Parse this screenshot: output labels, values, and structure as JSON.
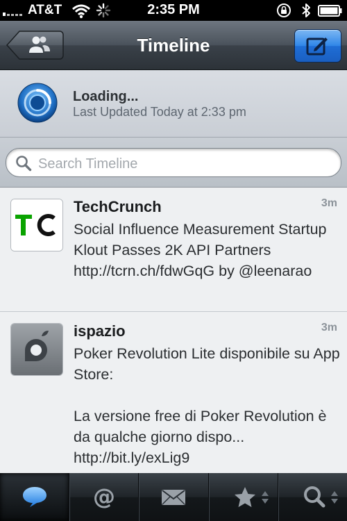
{
  "status_bar": {
    "carrier": "AT&T",
    "time": "2:35 PM",
    "icons": [
      "signal-icon",
      "wifi-icon",
      "activity-icon",
      "orientation-lock-icon",
      "bluetooth-icon",
      "battery-icon"
    ]
  },
  "nav_bar": {
    "title": "Timeline",
    "back_icon": "accounts-icon",
    "compose_icon": "compose-icon",
    "compose_color": "#2f86e8"
  },
  "refresh": {
    "status": "Loading...",
    "last_updated": "Last Updated Today at 2:33 pm"
  },
  "search": {
    "placeholder": "Search Timeline"
  },
  "timeline": [
    {
      "author": "TechCrunch",
      "age": "3m",
      "text": "Social Influence Measurement Startup Klout Passes 2K API Partners http://tcrn.ch/fdwGqG by @leenarao",
      "avatar": "TC"
    },
    {
      "author": "ispazio",
      "age": "3m",
      "text": "Poker Revolution Lite disponibile su App Store:\n\nLa versione free di Poker Revolution è da qualche giorno dispo... http://bit.ly/exLig9",
      "avatar": "ispazio-logo"
    }
  ],
  "tabs": [
    {
      "icon": "timeline-bubble-icon",
      "active": true
    },
    {
      "icon": "mentions-icon",
      "active": false
    },
    {
      "icon": "messages-icon",
      "active": false
    },
    {
      "icon": "favorites-icon",
      "active": false
    },
    {
      "icon": "search-icon",
      "active": false
    }
  ]
}
